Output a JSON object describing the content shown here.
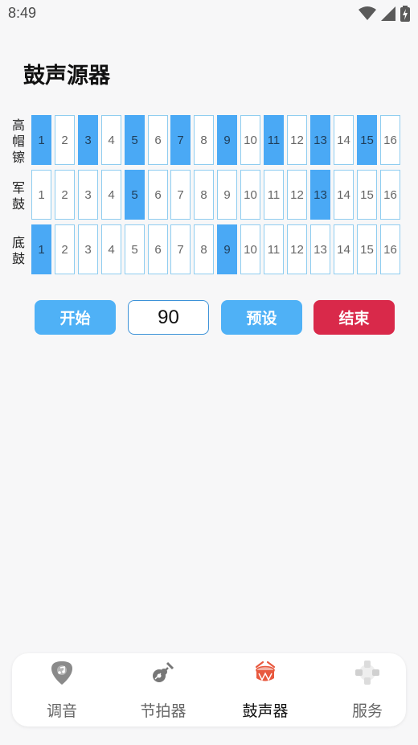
{
  "status": {
    "time": "8:49"
  },
  "page": {
    "title": "鼓声源器"
  },
  "tracks": [
    {
      "label": [
        "高",
        "帽",
        "镲"
      ],
      "active": [
        1,
        3,
        5,
        7,
        9,
        11,
        13,
        15
      ]
    },
    {
      "label": [
        "军",
        "鼓"
      ],
      "active": [
        5,
        13
      ]
    },
    {
      "label": [
        "底",
        "鼓"
      ],
      "active": [
        1,
        9
      ]
    }
  ],
  "steps": [
    "1",
    "2",
    "3",
    "4",
    "5",
    "6",
    "7",
    "8",
    "9",
    "10",
    "11",
    "12",
    "13",
    "14",
    "15",
    "16"
  ],
  "controls": {
    "start_label": "开始",
    "tempo_value": "90",
    "preset_label": "预设",
    "stop_label": "结束"
  },
  "nav": {
    "items": [
      {
        "label": "调音",
        "icon": "guitar-pick-icon"
      },
      {
        "label": "节拍器",
        "icon": "guitar-icon"
      },
      {
        "label": "鼓声器",
        "icon": "drum-icon",
        "active": true
      },
      {
        "label": "服务",
        "icon": "services-icon"
      }
    ]
  },
  "colors": {
    "active_cell": "#4aa9f5",
    "start_button": "#4fb1f6",
    "stop_button": "#d9294a"
  }
}
